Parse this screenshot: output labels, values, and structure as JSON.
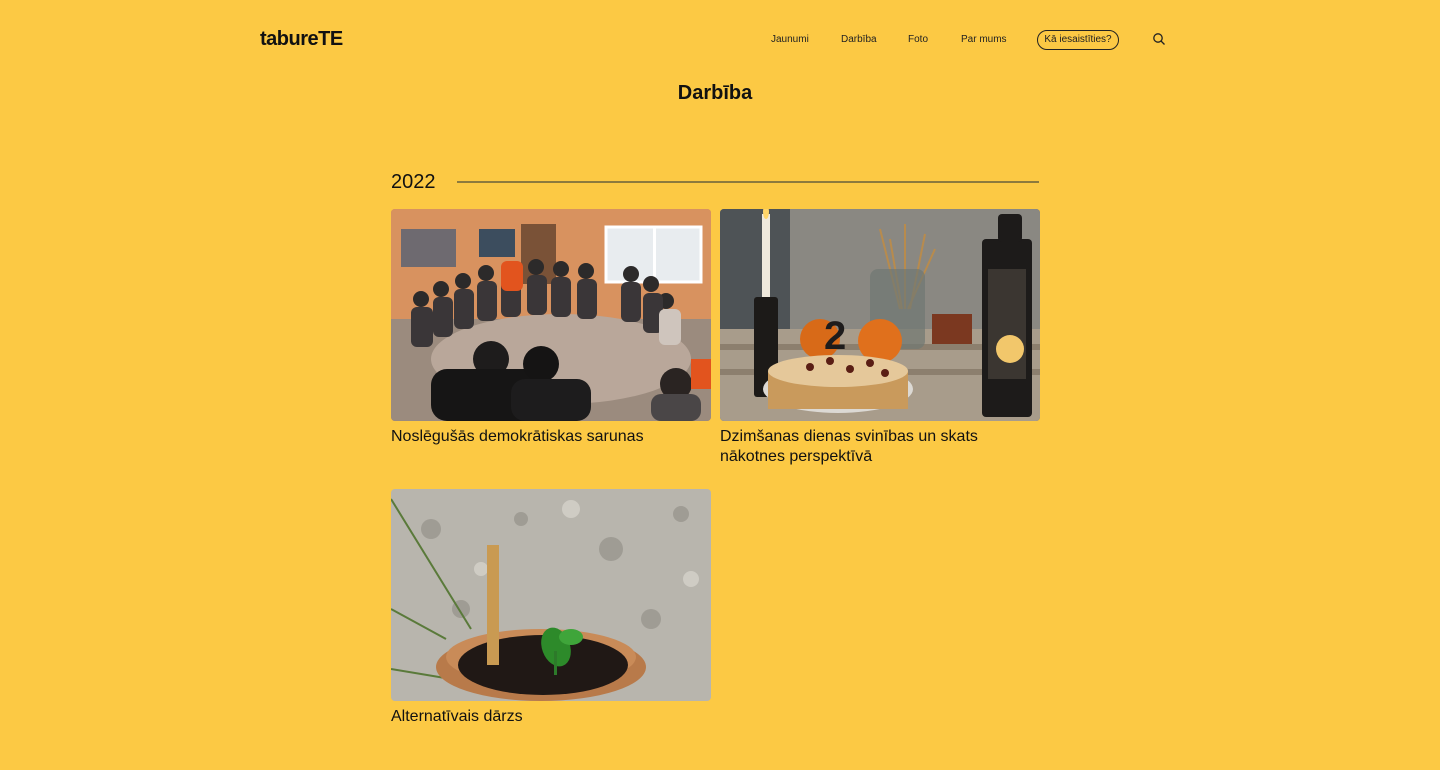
{
  "header": {
    "logo": "tabureTE",
    "nav": [
      "Jaunumi",
      "Darbība",
      "Foto",
      "Par mums"
    ],
    "cta_label": "Kā iesaistīties?"
  },
  "page": {
    "title": "Darbība"
  },
  "section": {
    "year": "2022",
    "cards": [
      {
        "title": "Noslēgušās demokrātiskas sarunas"
      },
      {
        "title": "Dzimšanas dienas svinības un skats nākotnes perspektīvā"
      },
      {
        "title": "Alternatīvais dārzs"
      }
    ]
  }
}
